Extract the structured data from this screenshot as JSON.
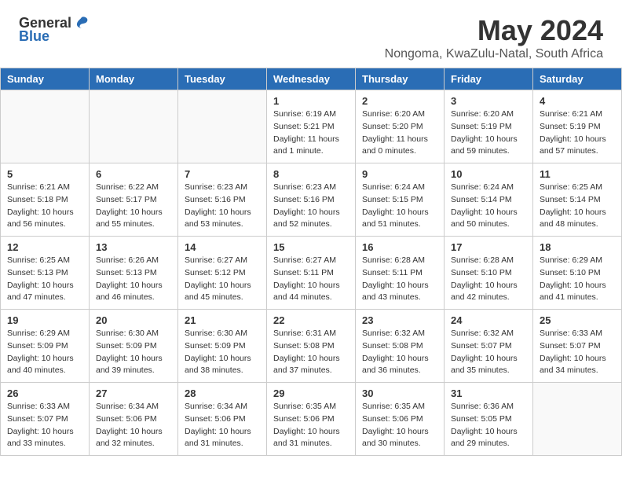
{
  "header": {
    "logo_general": "General",
    "logo_blue": "Blue",
    "title": "May 2024",
    "subtitle": "Nongoma, KwaZulu-Natal, South Africa"
  },
  "days_of_week": [
    "Sunday",
    "Monday",
    "Tuesday",
    "Wednesday",
    "Thursday",
    "Friday",
    "Saturday"
  ],
  "weeks": [
    [
      {
        "day": "",
        "info": ""
      },
      {
        "day": "",
        "info": ""
      },
      {
        "day": "",
        "info": ""
      },
      {
        "day": "1",
        "info": "Sunrise: 6:19 AM\nSunset: 5:21 PM\nDaylight: 11 hours\nand 1 minute."
      },
      {
        "day": "2",
        "info": "Sunrise: 6:20 AM\nSunset: 5:20 PM\nDaylight: 11 hours\nand 0 minutes."
      },
      {
        "day": "3",
        "info": "Sunrise: 6:20 AM\nSunset: 5:19 PM\nDaylight: 10 hours\nand 59 minutes."
      },
      {
        "day": "4",
        "info": "Sunrise: 6:21 AM\nSunset: 5:19 PM\nDaylight: 10 hours\nand 57 minutes."
      }
    ],
    [
      {
        "day": "5",
        "info": "Sunrise: 6:21 AM\nSunset: 5:18 PM\nDaylight: 10 hours\nand 56 minutes."
      },
      {
        "day": "6",
        "info": "Sunrise: 6:22 AM\nSunset: 5:17 PM\nDaylight: 10 hours\nand 55 minutes."
      },
      {
        "day": "7",
        "info": "Sunrise: 6:23 AM\nSunset: 5:16 PM\nDaylight: 10 hours\nand 53 minutes."
      },
      {
        "day": "8",
        "info": "Sunrise: 6:23 AM\nSunset: 5:16 PM\nDaylight: 10 hours\nand 52 minutes."
      },
      {
        "day": "9",
        "info": "Sunrise: 6:24 AM\nSunset: 5:15 PM\nDaylight: 10 hours\nand 51 minutes."
      },
      {
        "day": "10",
        "info": "Sunrise: 6:24 AM\nSunset: 5:14 PM\nDaylight: 10 hours\nand 50 minutes."
      },
      {
        "day": "11",
        "info": "Sunrise: 6:25 AM\nSunset: 5:14 PM\nDaylight: 10 hours\nand 48 minutes."
      }
    ],
    [
      {
        "day": "12",
        "info": "Sunrise: 6:25 AM\nSunset: 5:13 PM\nDaylight: 10 hours\nand 47 minutes."
      },
      {
        "day": "13",
        "info": "Sunrise: 6:26 AM\nSunset: 5:13 PM\nDaylight: 10 hours\nand 46 minutes."
      },
      {
        "day": "14",
        "info": "Sunrise: 6:27 AM\nSunset: 5:12 PM\nDaylight: 10 hours\nand 45 minutes."
      },
      {
        "day": "15",
        "info": "Sunrise: 6:27 AM\nSunset: 5:11 PM\nDaylight: 10 hours\nand 44 minutes."
      },
      {
        "day": "16",
        "info": "Sunrise: 6:28 AM\nSunset: 5:11 PM\nDaylight: 10 hours\nand 43 minutes."
      },
      {
        "day": "17",
        "info": "Sunrise: 6:28 AM\nSunset: 5:10 PM\nDaylight: 10 hours\nand 42 minutes."
      },
      {
        "day": "18",
        "info": "Sunrise: 6:29 AM\nSunset: 5:10 PM\nDaylight: 10 hours\nand 41 minutes."
      }
    ],
    [
      {
        "day": "19",
        "info": "Sunrise: 6:29 AM\nSunset: 5:09 PM\nDaylight: 10 hours\nand 40 minutes."
      },
      {
        "day": "20",
        "info": "Sunrise: 6:30 AM\nSunset: 5:09 PM\nDaylight: 10 hours\nand 39 minutes."
      },
      {
        "day": "21",
        "info": "Sunrise: 6:30 AM\nSunset: 5:09 PM\nDaylight: 10 hours\nand 38 minutes."
      },
      {
        "day": "22",
        "info": "Sunrise: 6:31 AM\nSunset: 5:08 PM\nDaylight: 10 hours\nand 37 minutes."
      },
      {
        "day": "23",
        "info": "Sunrise: 6:32 AM\nSunset: 5:08 PM\nDaylight: 10 hours\nand 36 minutes."
      },
      {
        "day": "24",
        "info": "Sunrise: 6:32 AM\nSunset: 5:07 PM\nDaylight: 10 hours\nand 35 minutes."
      },
      {
        "day": "25",
        "info": "Sunrise: 6:33 AM\nSunset: 5:07 PM\nDaylight: 10 hours\nand 34 minutes."
      }
    ],
    [
      {
        "day": "26",
        "info": "Sunrise: 6:33 AM\nSunset: 5:07 PM\nDaylight: 10 hours\nand 33 minutes."
      },
      {
        "day": "27",
        "info": "Sunrise: 6:34 AM\nSunset: 5:06 PM\nDaylight: 10 hours\nand 32 minutes."
      },
      {
        "day": "28",
        "info": "Sunrise: 6:34 AM\nSunset: 5:06 PM\nDaylight: 10 hours\nand 31 minutes."
      },
      {
        "day": "29",
        "info": "Sunrise: 6:35 AM\nSunset: 5:06 PM\nDaylight: 10 hours\nand 31 minutes."
      },
      {
        "day": "30",
        "info": "Sunrise: 6:35 AM\nSunset: 5:06 PM\nDaylight: 10 hours\nand 30 minutes."
      },
      {
        "day": "31",
        "info": "Sunrise: 6:36 AM\nSunset: 5:05 PM\nDaylight: 10 hours\nand 29 minutes."
      },
      {
        "day": "",
        "info": ""
      }
    ]
  ]
}
